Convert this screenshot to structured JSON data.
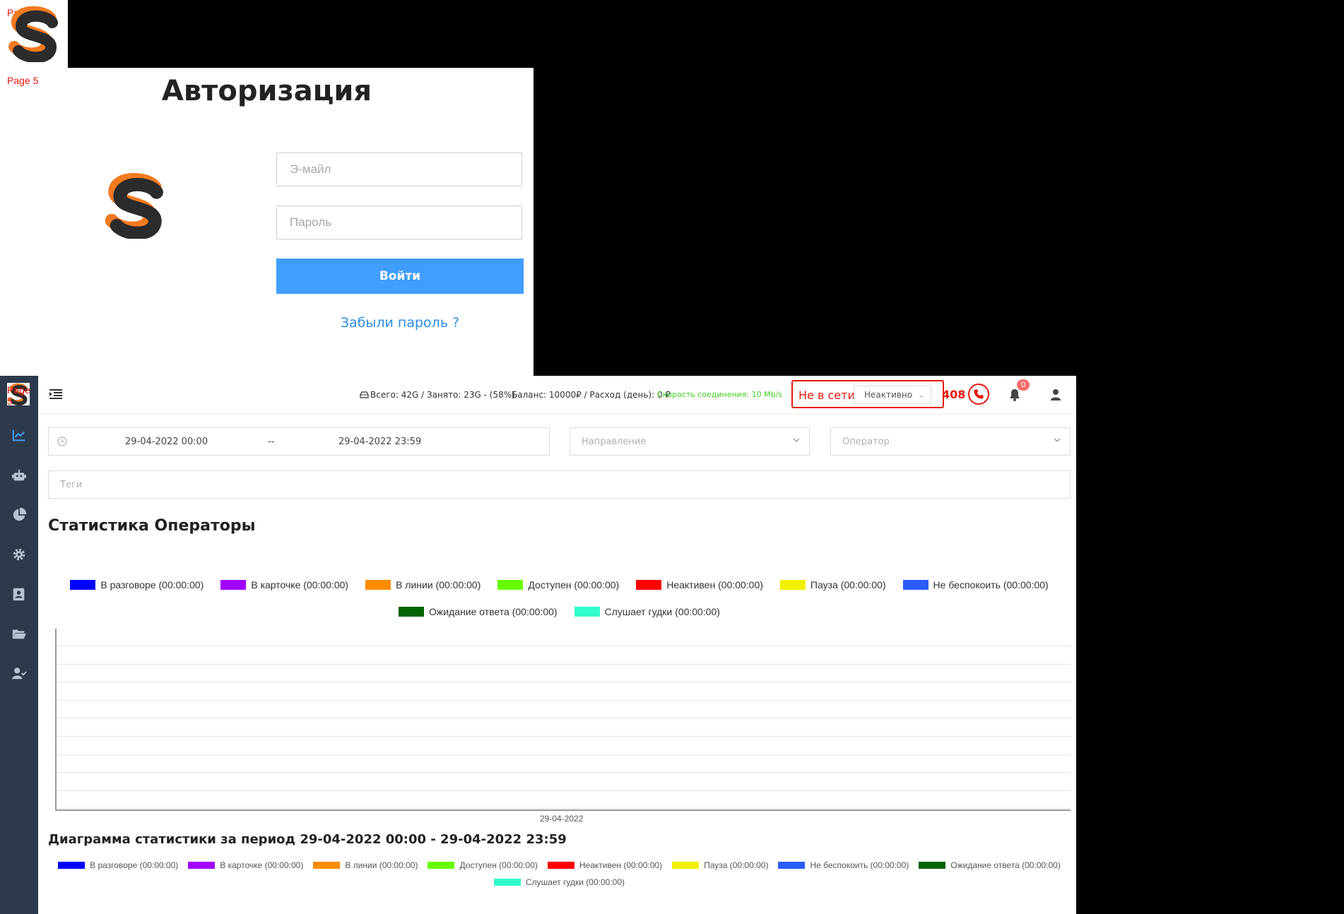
{
  "page_labels": [
    "Page 5",
    "Page 5",
    "Page 5"
  ],
  "login": {
    "title": "Авторизация",
    "email_placeholder": "Э-майл",
    "password_placeholder": "Пароль",
    "submit_label": "Войти",
    "forgot_label": "Забыли пароль ?"
  },
  "topbar": {
    "disk_info": "Всего: 42G / Занято: 23G - (58%)",
    "balance_info": "Баланс: 10000₽ / Расход (день): 0 ₽",
    "speed_info": "Скорость соединения: 10 Mb/s",
    "status_label": "Не в сети",
    "status_value": "Неактивно",
    "status_code": "408",
    "notification_count": "0"
  },
  "filters": {
    "date_from": "29-04-2022 00:00",
    "date_separator": "--",
    "date_to": "29-04-2022 23:59",
    "direction_placeholder": "Направление",
    "operator_placeholder": "Оператор",
    "tags_placeholder": "Теги"
  },
  "stats_title": "Статистика Операторы",
  "legend": [
    {
      "label": "В разговоре (00:00:00)",
      "color": "#0000ff"
    },
    {
      "label": "В карточке (00:00:00)",
      "color": "#a000ff"
    },
    {
      "label": "В линии (00:00:00)",
      "color": "#ff8c00"
    },
    {
      "label": "Доступен (00:00:00)",
      "color": "#66ff00"
    },
    {
      "label": "Неактивен (00:00:00)",
      "color": "#ff0000"
    },
    {
      "label": "Пауза (00:00:00)",
      "color": "#f0f000"
    },
    {
      "label": "Не беспокоить (00:00:00)",
      "color": "#2a5cff"
    },
    {
      "label": "Ожидание ответа (00:00:00)",
      "color": "#006400"
    },
    {
      "label": "Слушает гудки (00:00:00)",
      "color": "#30ffcc"
    }
  ],
  "chart_x_tick": "29-04-2022",
  "diagram_title": "Диаграмма статистики за период 29-04-2022 00:00 - 29-04-2022 23:59",
  "colors": {
    "sidebar_bg": "#2d3a4b",
    "accent": "#409eff",
    "logo_orange": "#f47a20",
    "logo_dark": "#2b2b2b",
    "alert": "#e8180c"
  },
  "sidebar_icons": [
    "chart-line-icon",
    "robot-icon",
    "pie-chart-icon",
    "gear-icon",
    "contact-card-icon",
    "folder-open-icon",
    "user-check-icon"
  ]
}
